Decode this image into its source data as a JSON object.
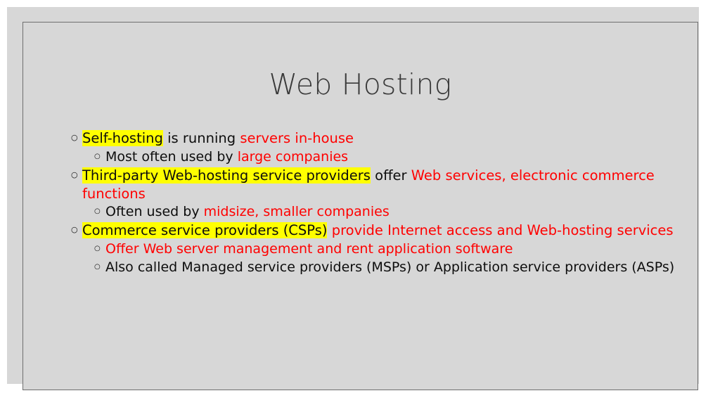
{
  "slide": {
    "title": "Web Hosting",
    "background_color": "#d7d7d7",
    "border_color": "#6e6e6e",
    "title_color": "#3a3a3a",
    "highlight_color": "#ffff00",
    "accent_color": "#ff0000",
    "text_color": "#0d0d0d",
    "bullet_marker": "○"
  },
  "content": {
    "bullets": [
      {
        "level": 1,
        "marker": "○",
        "runs": [
          {
            "text": "Self-hosting",
            "style": "highlight"
          },
          {
            "text": " is running ",
            "style": "plain"
          },
          {
            "text": "servers in-house",
            "style": "accent"
          }
        ]
      },
      {
        "level": 2,
        "marker": "○",
        "runs": [
          {
            "text": "Most often used by ",
            "style": "plain"
          },
          {
            "text": "large companies",
            "style": "accent"
          }
        ]
      },
      {
        "level": 1,
        "marker": "○",
        "runs": [
          {
            "text": "Third-party Web-hosting service providers",
            "style": "highlight"
          },
          {
            "text": " offer ",
            "style": "plain"
          },
          {
            "text": "Web services, electronic commerce functions",
            "style": "accent"
          }
        ]
      },
      {
        "level": 2,
        "marker": "○",
        "runs": [
          {
            "text": "Often used by ",
            "style": "plain"
          },
          {
            "text": "midsize, smaller companies",
            "style": "accent"
          }
        ]
      },
      {
        "level": 1,
        "marker": "○",
        "runs": [
          {
            "text": "Commerce service providers (CSPs)",
            "style": "highlight"
          },
          {
            "text": " ",
            "style": "plain"
          },
          {
            "text": "provide Internet access and Web-hosting services",
            "style": "accent"
          }
        ]
      },
      {
        "level": 2,
        "marker": "○",
        "runs": [
          {
            "text": "Offer Web server management and rent application software",
            "style": "accent"
          }
        ]
      },
      {
        "level": 2,
        "marker": "○",
        "runs": [
          {
            "text": "Also called Managed service providers (MSPs) or Application service providers (ASPs)",
            "style": "plain"
          }
        ]
      }
    ]
  }
}
